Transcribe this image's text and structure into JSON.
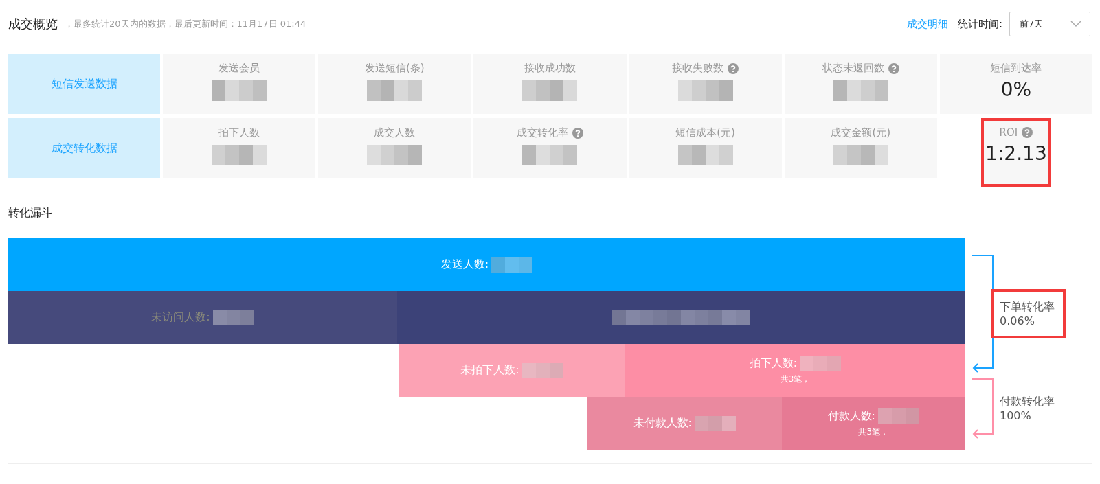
{
  "header": {
    "title": "成交概览",
    "note": "，最多统计20天内的数据，最后更新时间：11月17日 01:44",
    "detail_link": "成交明细",
    "period_label": "统计时间:",
    "period_select": {
      "value": "前7天"
    }
  },
  "stat_groups": [
    {
      "label": "短信发送数据",
      "metrics": [
        {
          "label": "发送会员",
          "help": false
        },
        {
          "label": "发送短信(条)",
          "help": false
        },
        {
          "label": "接收成功数",
          "help": false
        },
        {
          "label": "接收失败数",
          "help": true
        },
        {
          "label": "状态未返回数",
          "help": true
        },
        {
          "label": "短信到达率",
          "help": false,
          "value": "0%",
          "highlighted": false
        }
      ]
    },
    {
      "label": "成交转化数据",
      "metrics": [
        {
          "label": "拍下人数",
          "help": false
        },
        {
          "label": "成交人数",
          "help": false
        },
        {
          "label": "成交转化率",
          "help": true
        },
        {
          "label": "短信成本(元)",
          "help": false
        },
        {
          "label": "成交金额(元)",
          "help": false
        },
        {
          "label": "ROI",
          "help": true,
          "value": "1:2.13",
          "highlighted": true
        }
      ]
    }
  ],
  "funnel": {
    "title": "转化漏斗",
    "rows": [
      [
        {
          "kind": "send",
          "label": "发送人数:"
        }
      ],
      [
        {
          "kind": "unvisited",
          "label": "未访问人数:"
        },
        {
          "kind": "visited"
        }
      ],
      [
        {
          "kind": "not_ordered",
          "label": "未拍下人数:"
        },
        {
          "kind": "ordered",
          "label": "拍下人数:",
          "note": "共3笔，"
        }
      ],
      [
        {
          "kind": "unpaid",
          "label": "未付款人数:"
        },
        {
          "kind": "paid",
          "label": "付款人数:",
          "note": "共3笔，"
        }
      ]
    ],
    "rates": [
      {
        "label": "下单转化率",
        "value": "0.06%",
        "color": "#1aa3ff",
        "highlighted": true
      },
      {
        "label": "付款转化率",
        "value": "100%",
        "color": "#ff8fa8",
        "highlighted": false
      }
    ]
  }
}
